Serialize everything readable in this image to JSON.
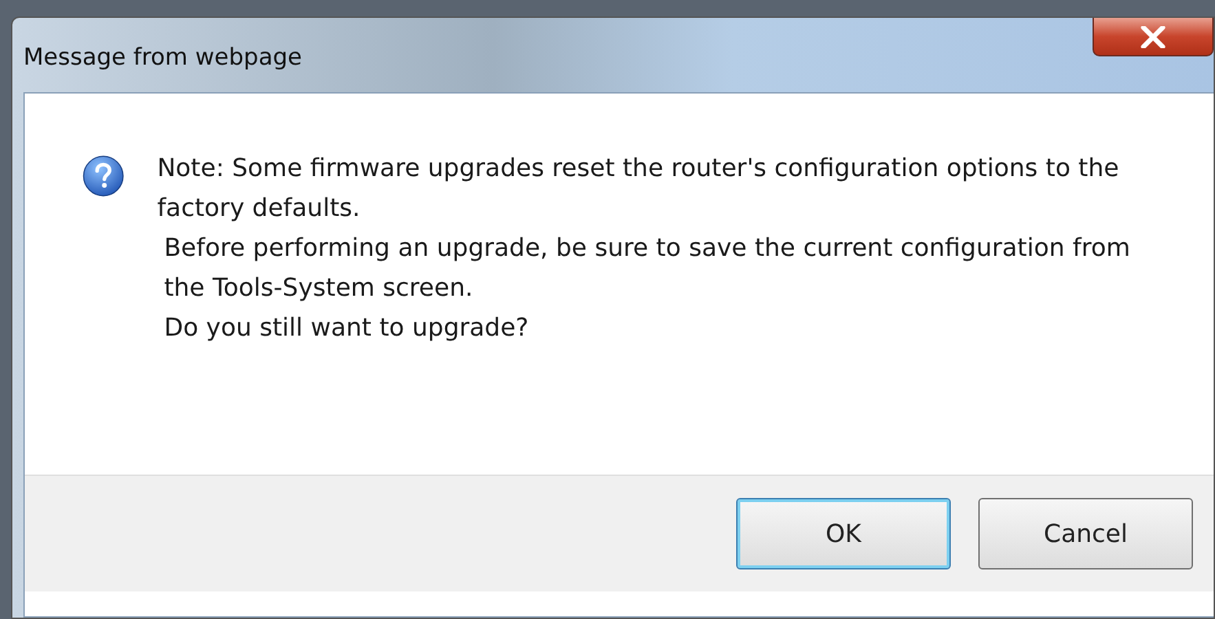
{
  "window": {
    "title": "Message from webpage"
  },
  "message": [
    "Note: Some firmware upgrades reset the router's configuration options to the factory defaults.",
    "Before performing an upgrade, be sure to save the current configuration from the Tools-System screen.",
    "Do you still want to upgrade?"
  ],
  "buttons": [
    {
      "label": "OK",
      "default": true
    },
    {
      "label": "Cancel",
      "default": false
    }
  ]
}
